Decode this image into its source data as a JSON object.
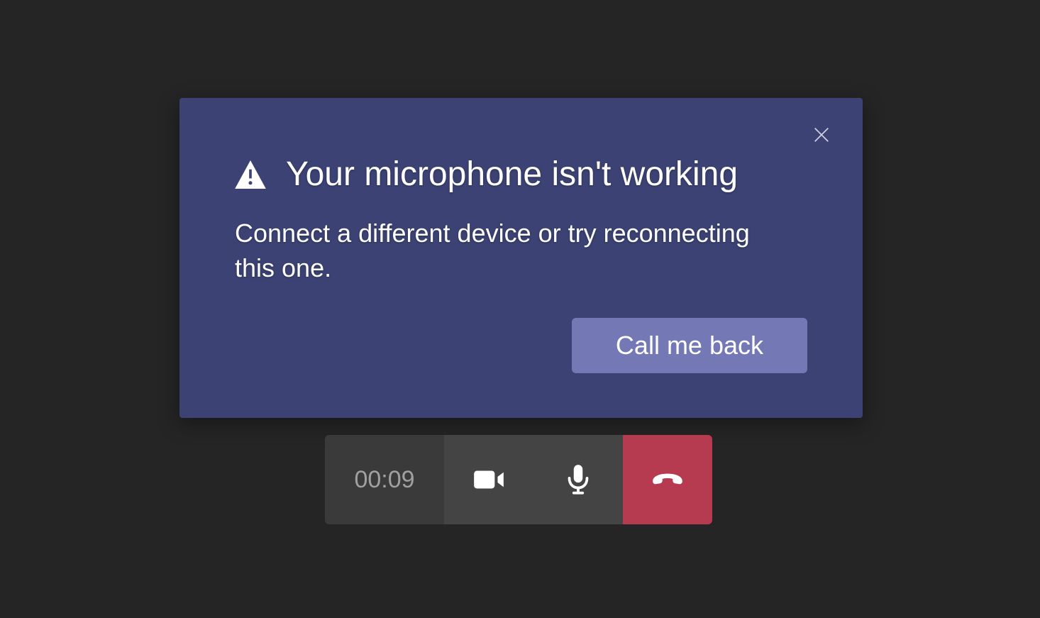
{
  "dialog": {
    "title": "Your microphone isn't working",
    "body": "Connect a different device or try reconnecting this one.",
    "callback_button": "Call me back"
  },
  "call_controls": {
    "timer": "00:09"
  },
  "colors": {
    "background": "#252525",
    "dialog_bg": "#3c4374",
    "button_primary": "#7479b5",
    "hangup": "#b73b50"
  }
}
